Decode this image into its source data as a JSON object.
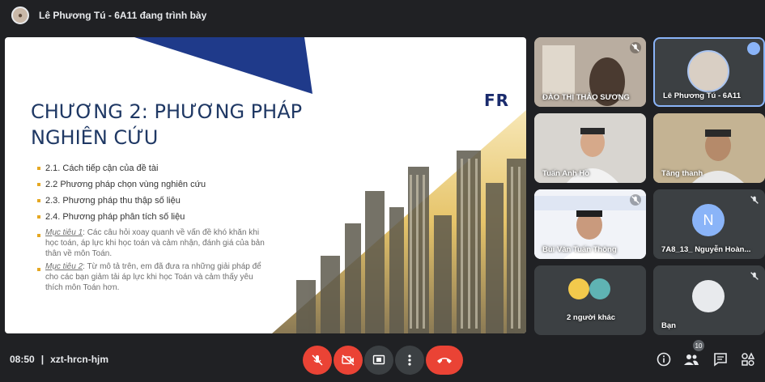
{
  "topbar": {
    "presenting_label": "Lê Phương Tú - 6A11 đang trình bày"
  },
  "slide": {
    "logo": "FR",
    "title": "CHƯƠNG 2: PHƯƠNG PHÁP NGHIÊN CỨU",
    "items": [
      "2.1. Cách tiếp cận của đề tài",
      "2.2 Phương pháp chọn vùng nghiên cứu",
      "2.3. Phương pháp thu thập số liệu",
      "2.4. Phương pháp phân tích số liệu"
    ],
    "goal1_label": "Mục tiêu 1",
    "goal1_text": ": Các câu hỏi xoay quanh về vấn đề khó khăn khi học toán, áp lực khi học toán và cảm nhận, đánh giá của bản thân về môn Toán.",
    "goal2_label": "Mục tiêu 2",
    "goal2_text": ": Từ mô tả trên, em đã đưa ra những giải pháp để cho các bạn giảm tải áp lực khi học Toán và cảm thấy yêu thích môn Toán hơn."
  },
  "participants": [
    {
      "name": "ĐÀO THỊ THẢO SƯƠNG",
      "mic_muted": true
    },
    {
      "name": "Lê Phương Tú - 6A11",
      "speaking": true
    },
    {
      "name": "Tuấn Anh Hồ",
      "mic_muted": false
    },
    {
      "name": "Tăng thanh",
      "mic_muted": false
    },
    {
      "name": "Bùi Văn Tuấn Thông",
      "mic_muted": true
    },
    {
      "name": "7A8_13_ Nguyễn Hoàn...",
      "initial": "N",
      "mic_muted": true
    },
    {
      "name": "2 người khác"
    },
    {
      "name": "Bạn",
      "mic_muted": true
    }
  ],
  "bottombar": {
    "time": "08:50",
    "separator": "|",
    "meeting_code": "xzt-hrcn-hjm",
    "participant_count": "10"
  },
  "colors": {
    "end_call": "#ea4335",
    "muted_control": "#ea4335",
    "accent_blue": "#8ab4f8"
  }
}
